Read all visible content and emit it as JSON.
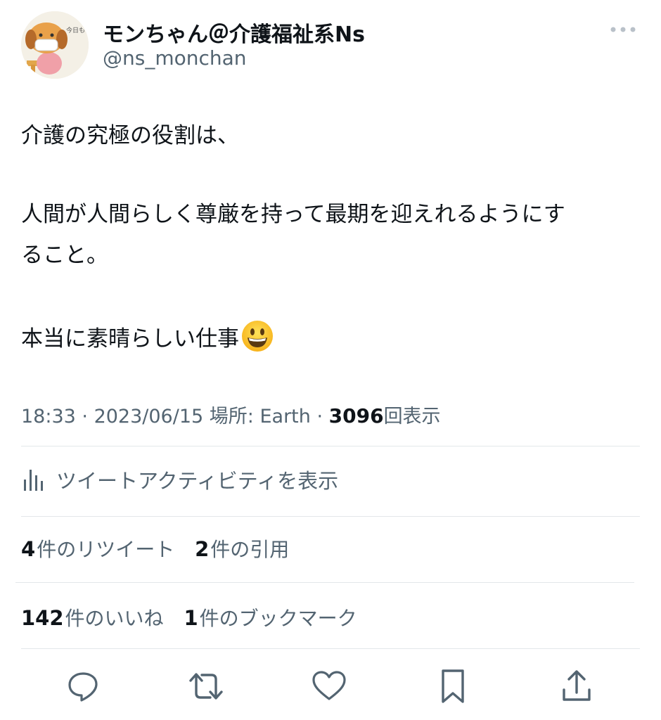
{
  "user": {
    "display_name": "モンちゃん＠介護福祉系Ns",
    "handle": "@ns_monchan"
  },
  "tweet": {
    "lines": [
      "介護の究極の役割は、",
      "人間が人間らしく尊厳を持って最期を迎えれるようにす",
      "ること。",
      "本当に素晴らしい仕事"
    ],
    "emoji": "grinning-face"
  },
  "meta": {
    "time": "18:33",
    "date": "2023/06/15",
    "location_label": "場所: Earth",
    "views": "3096",
    "views_label": "回表示"
  },
  "activity_label": "ツイートアクティビティを表示",
  "stats": {
    "retweets": {
      "count": "4",
      "label": "件のリツイート"
    },
    "quotes": {
      "count": "2",
      "label": "件の引用"
    },
    "likes": {
      "count": "142",
      "label": "件のいいね"
    },
    "bookmarks": {
      "count": "1",
      "label": "件のブックマーク"
    }
  },
  "actions": [
    "reply-icon",
    "retweet-icon",
    "like-icon",
    "bookmark-icon",
    "share-icon"
  ],
  "colors": {
    "icon": "#536471",
    "text": "#0f1419",
    "secondary": "#536471",
    "divider": "#e3e7ea"
  }
}
